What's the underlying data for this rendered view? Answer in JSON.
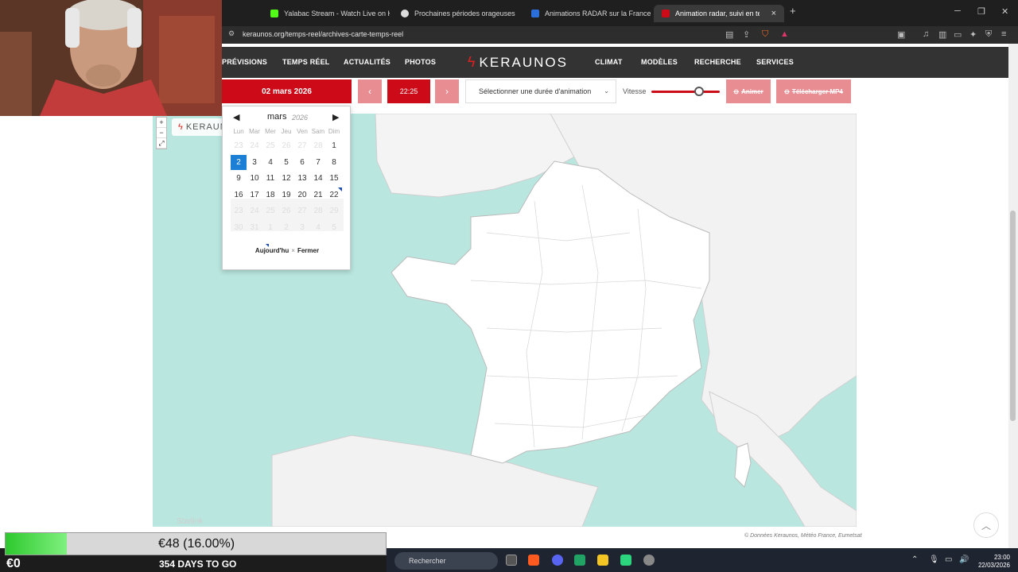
{
  "browser": {
    "tabs": [
      {
        "title": "Yalabac Stream - Watch Live on Kick",
        "fav_color": "#53fc18"
      },
      {
        "title": "Prochaines périodes orageuses",
        "fav_color": "#dddddd"
      },
      {
        "title": "Animations RADAR sur la France par",
        "fav_color": "#2b6fdb"
      },
      {
        "title": "Animation radar, suivi en temps",
        "fav_color": "#cc0a18"
      }
    ],
    "new_tab": "+",
    "close_tab": "×",
    "url": "keraunos.org/temps-reel/archives-carte-temps-reel"
  },
  "site": {
    "nav_left": [
      "PRÉVISIONS",
      "TEMPS RÉEL",
      "ACTUALITÉS",
      "PHOTOS"
    ],
    "logo": "KERAUNOS",
    "nav_right": [
      "CLIMAT",
      "MODÈLES",
      "RECHERCHE",
      "SERVICES"
    ]
  },
  "controls": {
    "date": "02 mars 2026",
    "prev": "‹",
    "time": "22:25",
    "next": "›",
    "duration_placeholder": "Sélectionner une durée d'animation",
    "speed_label": "Vitesse",
    "speed_level": 0.7,
    "animate": "Animer",
    "download": "Télécharger MP4"
  },
  "datepicker": {
    "month": "mars",
    "year": "2026",
    "weekdays": [
      "Lun",
      "Mar",
      "Mer",
      "Jeu",
      "Ven",
      "Sam",
      "Dim"
    ],
    "weeks": [
      [
        "23",
        "24",
        "25",
        "26",
        "27",
        "28",
        "1"
      ],
      [
        "2",
        "3",
        "4",
        "5",
        "6",
        "7",
        "8"
      ],
      [
        "9",
        "10",
        "11",
        "12",
        "13",
        "14",
        "15"
      ],
      [
        "16",
        "17",
        "18",
        "19",
        "20",
        "21",
        "22"
      ],
      [
        "23",
        "24",
        "25",
        "26",
        "27",
        "28",
        "29"
      ],
      [
        "30",
        "31",
        "1",
        "2",
        "3",
        "4",
        "5"
      ]
    ],
    "today": "Aujourd'hu",
    "separator": "×",
    "close": "Fermer"
  },
  "map": {
    "logo": "KERAUNOS",
    "watermark": "Starlink",
    "credits": "© Données Keraunos, Météo France, Eumetsat",
    "sea_color": "#b9e6df"
  },
  "overlay": {
    "donation_amount": "€48 (16.00%)",
    "donation_progress": 0.16,
    "current": "€0",
    "countdown": "354 DAYS TO GO"
  },
  "taskbar": {
    "search": "Rechercher",
    "time": "23:00",
    "date": "22/03/2026"
  }
}
